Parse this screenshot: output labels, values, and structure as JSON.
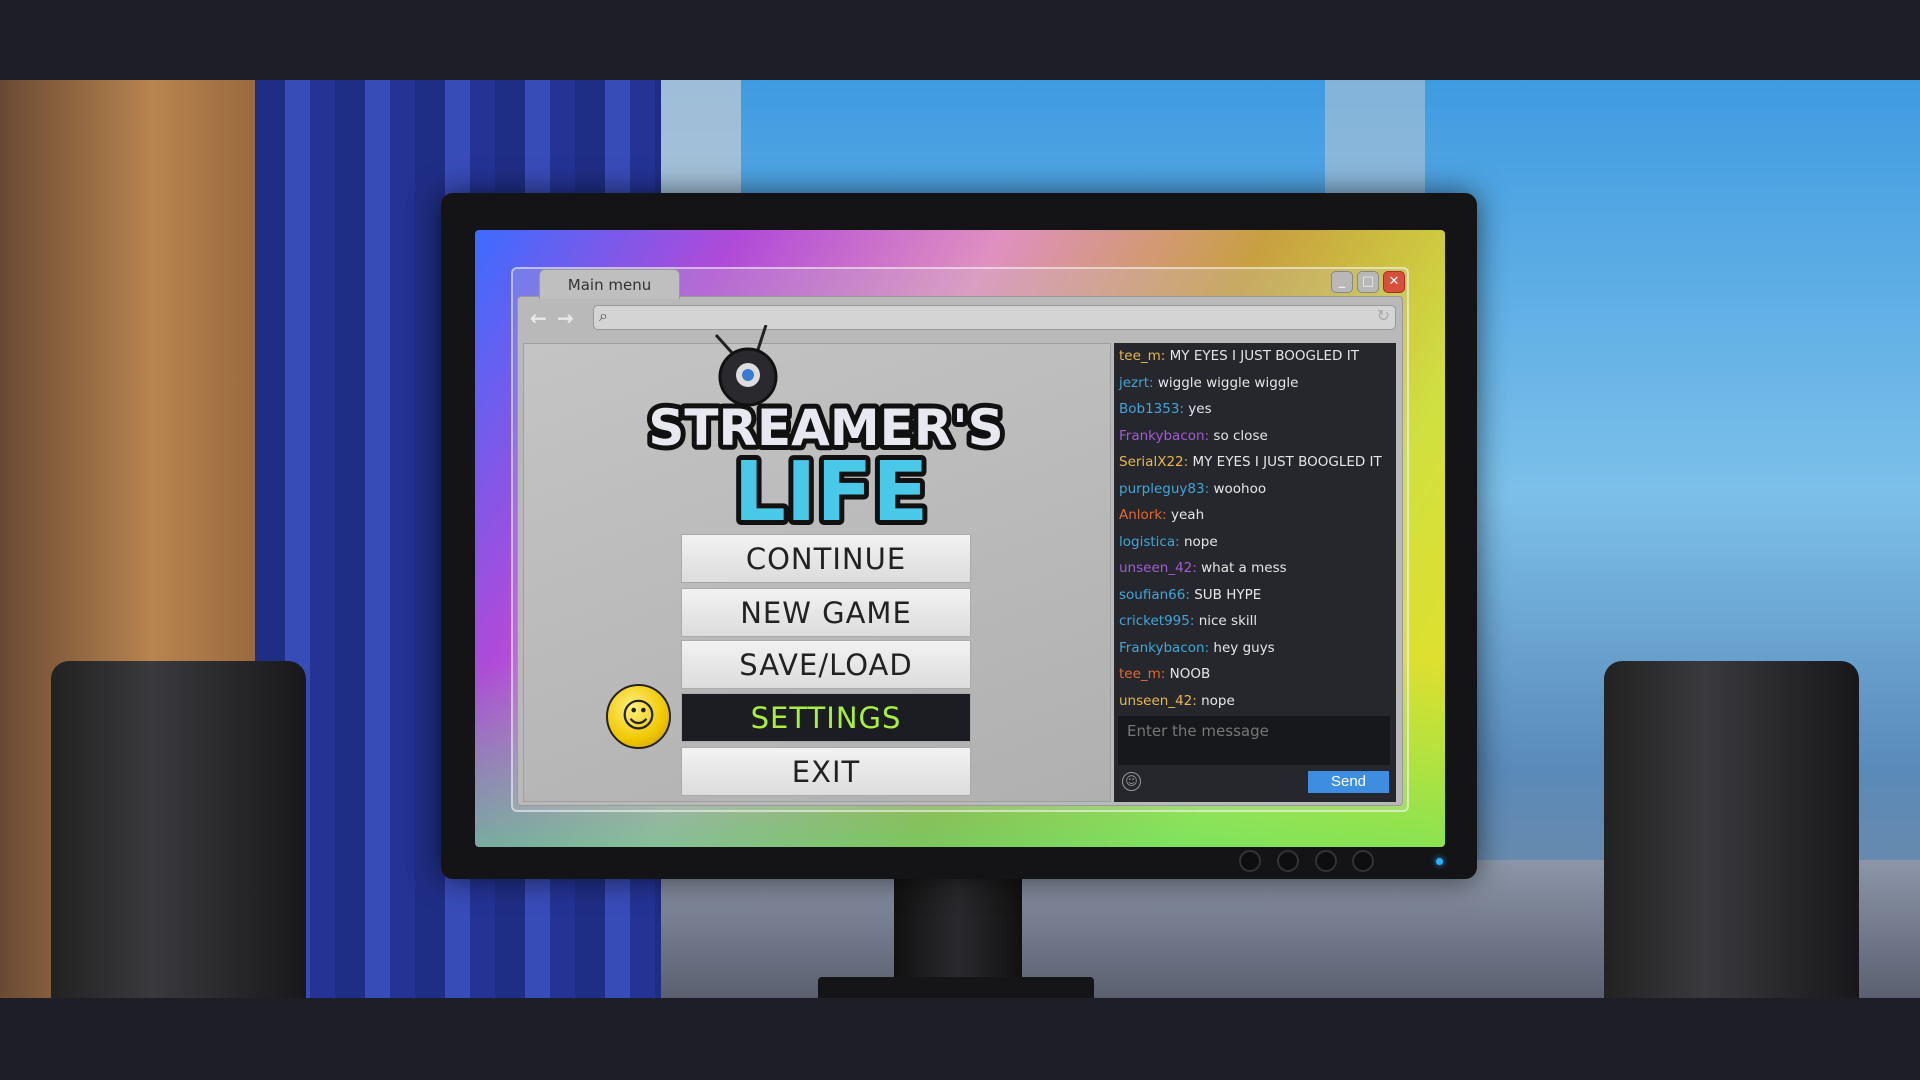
{
  "window": {
    "tab_title": "Main menu",
    "search_placeholder": ""
  },
  "logo": {
    "line1": "STREAMER'S",
    "line2": "LIFE"
  },
  "menu": {
    "items": [
      {
        "label": "CONTINUE",
        "selected": false
      },
      {
        "label": "NEW GAME",
        "selected": false
      },
      {
        "label": "SAVE/LOAD",
        "selected": false
      },
      {
        "label": "SETTINGS",
        "selected": true
      },
      {
        "label": "EXIT",
        "selected": false
      }
    ]
  },
  "chat": {
    "messages": [
      {
        "user": "tee_m:",
        "text": "MY EYES I JUST BOOGLED IT",
        "color": "#e8b84a"
      },
      {
        "user": "jezrt:",
        "text": "wiggle wiggle wiggle",
        "color": "#3fa6d8"
      },
      {
        "user": "Bob1353:",
        "text": "yes",
        "color": "#3fa6d8"
      },
      {
        "user": "Frankybacon:",
        "text": "so close",
        "color": "#a05cd0"
      },
      {
        "user": "SerialX22:",
        "text": "MY EYES I JUST BOOGLED IT",
        "color": "#e8b84a"
      },
      {
        "user": "purpleguy83:",
        "text": "woohoo",
        "color": "#3fa6d8"
      },
      {
        "user": "Anlork:",
        "text": "yeah",
        "color": "#e06a30"
      },
      {
        "user": "logistica:",
        "text": "nope",
        "color": "#3fa6d8"
      },
      {
        "user": "unseen_42:",
        "text": "what a mess",
        "color": "#a05cd0"
      },
      {
        "user": "soufian66:",
        "text": "SUB HYPE",
        "color": "#3fa6d8"
      },
      {
        "user": "cricket995:",
        "text": "nice skill",
        "color": "#3fa6d8"
      },
      {
        "user": "Frankybacon:",
        "text": "hey guys",
        "color": "#3fa6d8"
      },
      {
        "user": "tee_m:",
        "text": "NOOB",
        "color": "#e06a30"
      },
      {
        "user": "unseen_42:",
        "text": "nope",
        "color": "#e8b84a"
      }
    ],
    "input_placeholder": "Enter the message",
    "send_label": "Send"
  },
  "icons": {
    "back": "arrow-left-icon",
    "forward": "arrow-right-icon",
    "search": "search-icon",
    "reload": "reload-icon",
    "emoji": "smiley-icon"
  }
}
